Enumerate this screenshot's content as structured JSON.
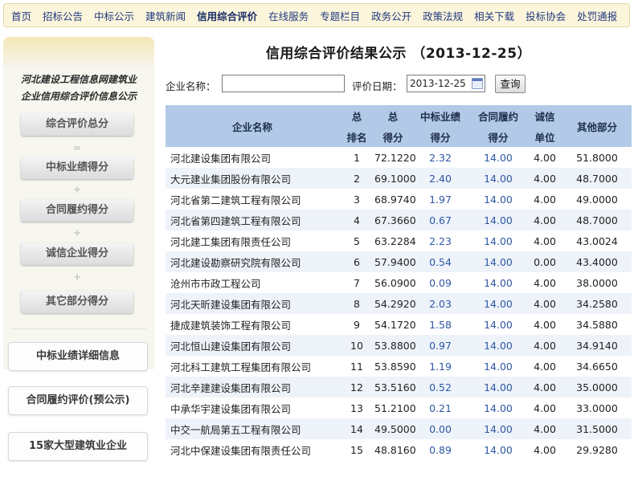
{
  "nav": [
    {
      "label": "首页"
    },
    {
      "label": "招标公告"
    },
    {
      "label": "中标公示"
    },
    {
      "label": "建筑新闻"
    },
    {
      "label": "信用综合评价",
      "active": true
    },
    {
      "label": "在线服务"
    },
    {
      "label": "专题栏目"
    },
    {
      "label": "政务公开"
    },
    {
      "label": "政策法规"
    },
    {
      "label": "相关下载"
    },
    {
      "label": "投标协会"
    },
    {
      "label": "处罚通报"
    }
  ],
  "sidebar": {
    "title_line1": "河北建设工程信息网建筑业",
    "title_line2": "企业信用综合评价信息公示",
    "total_btn": "综合评价总分",
    "eq": "=",
    "plus": "+",
    "components": [
      "中标业绩得分",
      "合同履约得分",
      "诚信企业得分",
      "其它部分得分"
    ],
    "links": [
      "中标业绩详细信息",
      "合同履约评价(预公示)",
      "15家大型建筑业企业"
    ]
  },
  "page": {
    "title": "信用综合评价结果公示 （2013-12-25）",
    "company_label": "企业名称：",
    "company_value": "",
    "date_label": "评价日期：",
    "date_value": "2013-12-25",
    "query_button": "查询"
  },
  "table": {
    "headers": {
      "name": "企业名称",
      "rank": [
        "总",
        "排名"
      ],
      "total": [
        "总",
        "得分"
      ],
      "bid": [
        "中标业绩",
        "得分"
      ],
      "contract": [
        "合同履约",
        "得分"
      ],
      "integrity": [
        "诚信",
        "单位"
      ],
      "other": "其他部分"
    },
    "rows": [
      {
        "name": "河北建设集团有限公司",
        "rank": "1",
        "total": "72.1220",
        "bid": "2.32",
        "contract": "14.00",
        "integrity": "4.00",
        "other": "51.8000"
      },
      {
        "name": "大元建业集团股份有限公司",
        "rank": "2",
        "total": "69.1000",
        "bid": "2.40",
        "contract": "14.00",
        "integrity": "4.00",
        "other": "48.7000"
      },
      {
        "name": "河北省第二建筑工程有限公司",
        "rank": "3",
        "total": "68.9740",
        "bid": "1.97",
        "contract": "14.00",
        "integrity": "4.00",
        "other": "49.0000"
      },
      {
        "name": "河北省第四建筑工程有限公司",
        "rank": "4",
        "total": "67.3660",
        "bid": "0.67",
        "contract": "14.00",
        "integrity": "4.00",
        "other": "48.7000"
      },
      {
        "name": "河北建工集团有限责任公司",
        "rank": "5",
        "total": "63.2284",
        "bid": "2.23",
        "contract": "14.00",
        "integrity": "4.00",
        "other": "43.0024"
      },
      {
        "name": "河北建设勘察研究院有限公司",
        "rank": "6",
        "total": "57.9400",
        "bid": "0.54",
        "contract": "14.00",
        "integrity": "0.00",
        "other": "43.4000"
      },
      {
        "name": "沧州市市政工程公司",
        "rank": "7",
        "total": "56.0900",
        "bid": "0.09",
        "contract": "14.00",
        "integrity": "4.00",
        "other": "38.0000"
      },
      {
        "name": "河北天昕建设集团有限公司",
        "rank": "8",
        "total": "54.2920",
        "bid": "2.03",
        "contract": "14.00",
        "integrity": "4.00",
        "other": "34.2580"
      },
      {
        "name": "捷成建筑装饰工程有限公司",
        "rank": "9",
        "total": "54.1720",
        "bid": "1.58",
        "contract": "14.00",
        "integrity": "4.00",
        "other": "34.5880"
      },
      {
        "name": "河北恒山建设集团有限公司",
        "rank": "10",
        "total": "53.8800",
        "bid": "0.97",
        "contract": "14.00",
        "integrity": "4.00",
        "other": "34.9140"
      },
      {
        "name": "河北科工建筑工程集团有限公司",
        "rank": "11",
        "total": "53.8590",
        "bid": "1.19",
        "contract": "14.00",
        "integrity": "4.00",
        "other": "34.6650"
      },
      {
        "name": "河北辛建建设集团有限公司",
        "rank": "12",
        "total": "53.5160",
        "bid": "0.52",
        "contract": "14.00",
        "integrity": "4.00",
        "other": "35.0000"
      },
      {
        "name": "中承华宇建设集团有限公司",
        "rank": "13",
        "total": "51.2100",
        "bid": "0.21",
        "contract": "14.00",
        "integrity": "4.00",
        "other": "33.0000"
      },
      {
        "name": "中交一航局第五工程有限公司",
        "rank": "14",
        "total": "49.5000",
        "bid": "0.00",
        "contract": "14.00",
        "integrity": "4.00",
        "other": "31.5000"
      },
      {
        "name": "河北中保建设集团有限责任公司",
        "rank": "15",
        "total": "48.8160",
        "bid": "0.89",
        "contract": "14.00",
        "integrity": "4.00",
        "other": "29.9280"
      }
    ]
  },
  "colors": {
    "header_bg": "#b2c9e7",
    "link_blue": "#2e57a3",
    "nav_bg": "#fbf5dc"
  }
}
